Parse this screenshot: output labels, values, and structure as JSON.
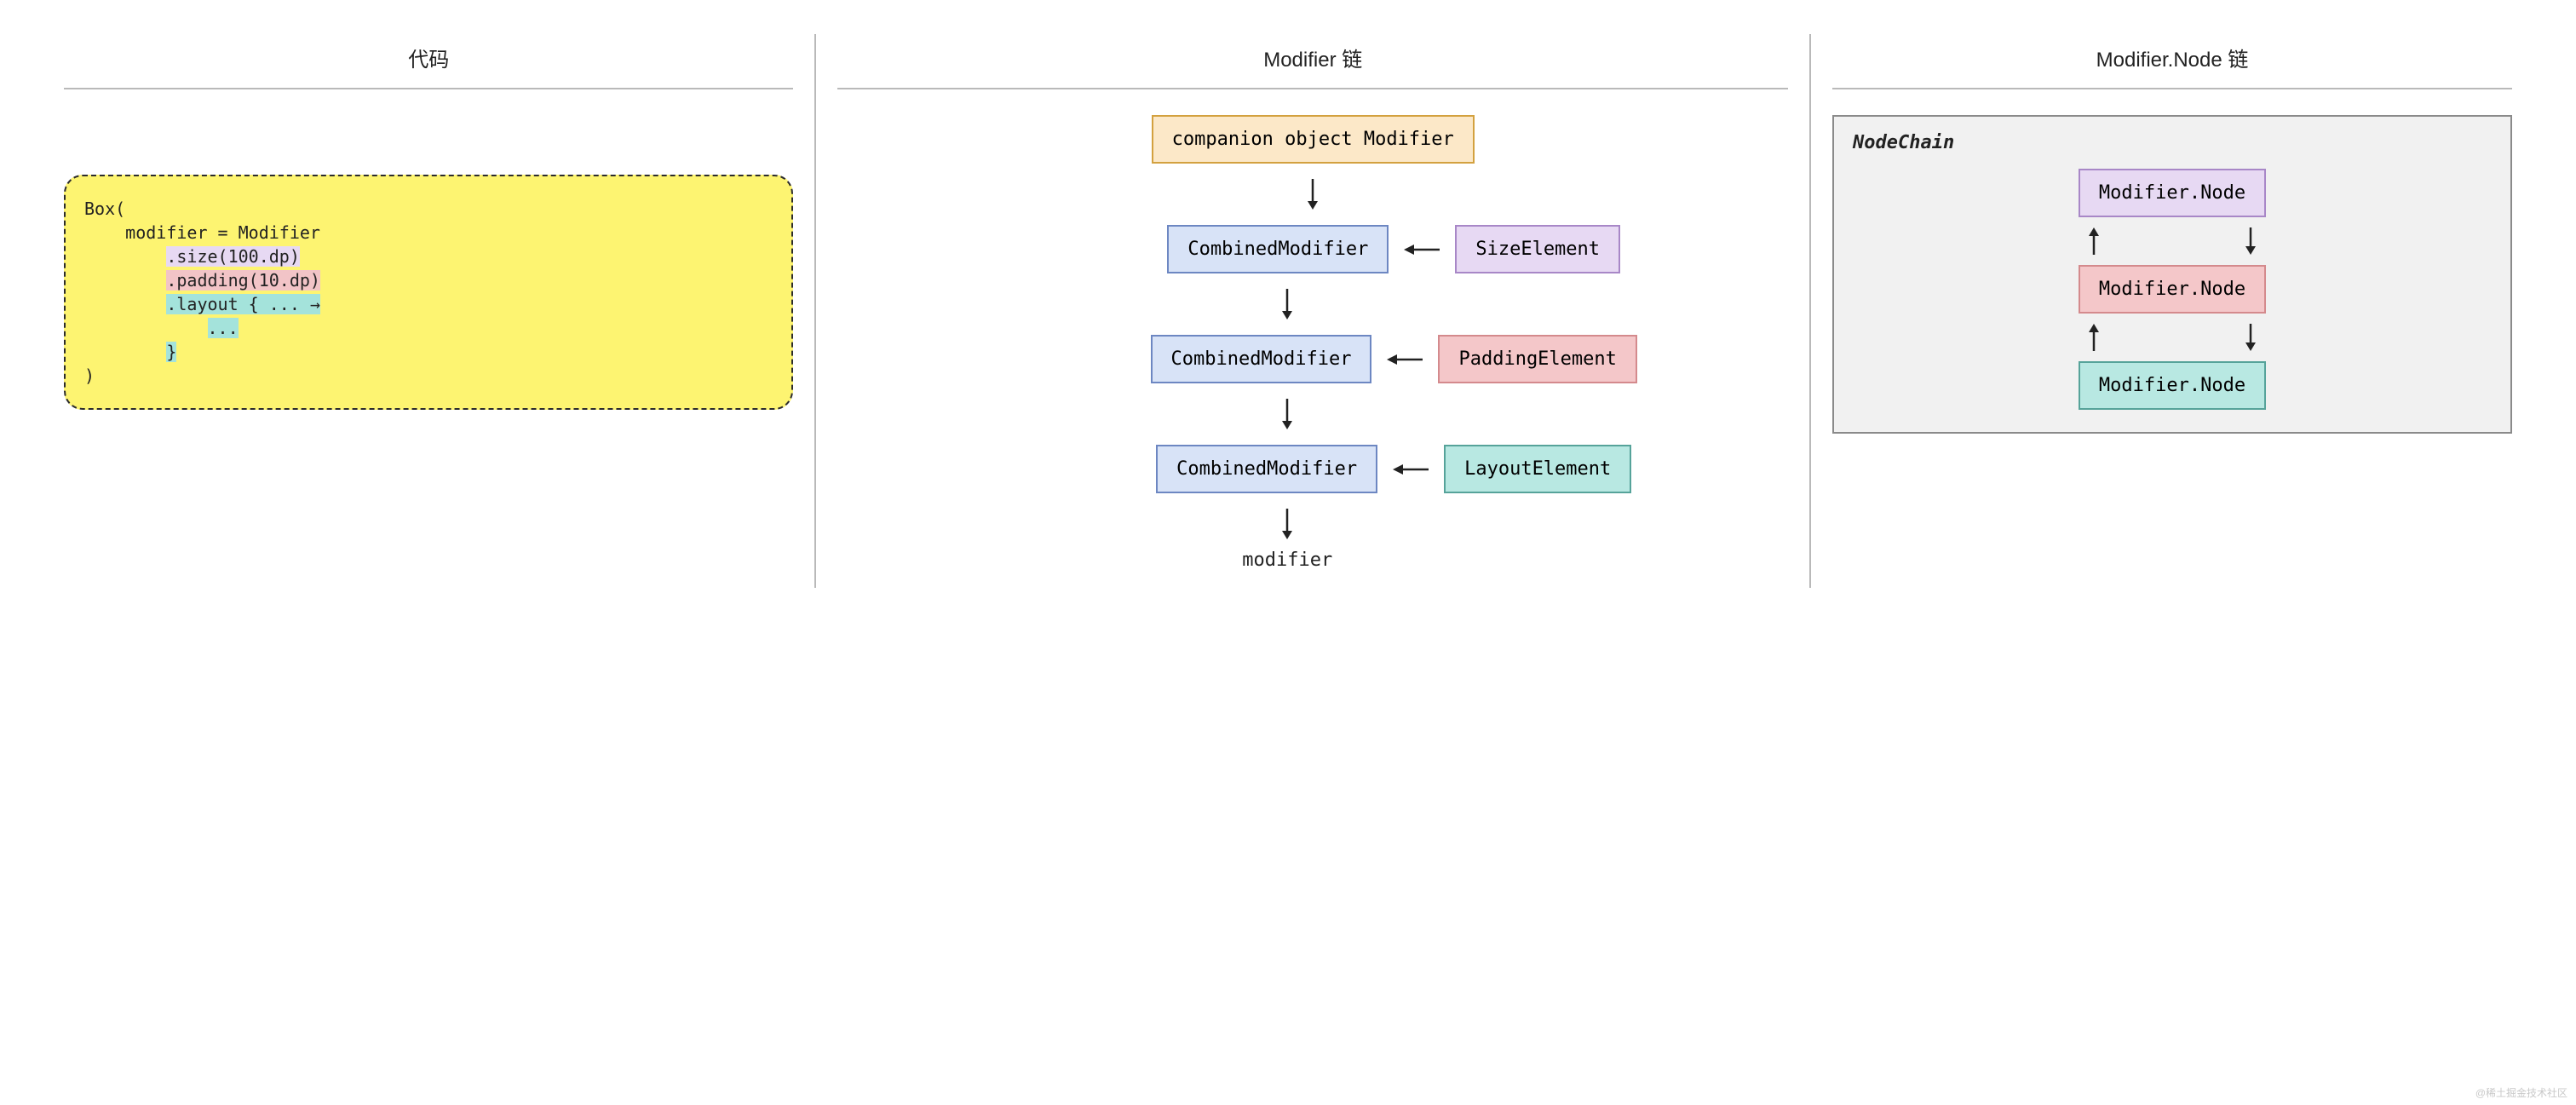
{
  "columns": {
    "code_header": "代码",
    "modifier_chain_header": "Modifier 链",
    "node_chain_header": "Modifier.Node 链"
  },
  "code": {
    "line1": "Box(",
    "line2_a": "    modifier = Modifier",
    "size_call": ".size(100.dp)",
    "padding_call": ".padding(10.dp)",
    "layout_call_open": ".layout { ... →",
    "layout_call_body": "...",
    "layout_call_close": "}",
    "close_paren": ")"
  },
  "modifier_chain": {
    "companion": "companion object Modifier",
    "combined": "CombinedModifier",
    "size_element": "SizeElement",
    "padding_element": "PaddingElement",
    "layout_element": "LayoutElement",
    "end_label": "modifier"
  },
  "node_chain": {
    "panel_title": "NodeChain",
    "node_label": "Modifier.Node"
  },
  "watermark": "@稀土掘金技术社区"
}
